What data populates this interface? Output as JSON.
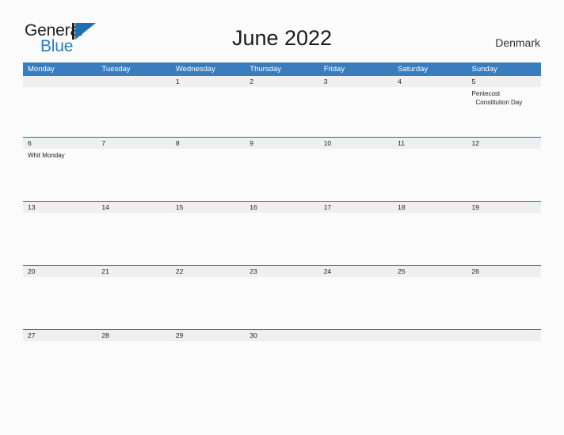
{
  "brand": {
    "name_part1": "General",
    "name_part2": "Blue",
    "accent_color": "#2b7cc0",
    "logo_flag_icon": "triangle-flag-icon"
  },
  "header": {
    "title": "June 2022",
    "country": "Denmark"
  },
  "calendar": {
    "header_bg": "#3a7dbf",
    "date_band_bg": "#efefef",
    "week_rule_color": "#2e6da4",
    "weekdays": [
      "Monday",
      "Tuesday",
      "Wednesday",
      "Thursday",
      "Friday",
      "Saturday",
      "Sunday"
    ],
    "weeks": [
      {
        "days": [
          {
            "date": "",
            "events": []
          },
          {
            "date": "",
            "events": []
          },
          {
            "date": "1",
            "events": []
          },
          {
            "date": "2",
            "events": []
          },
          {
            "date": "3",
            "events": []
          },
          {
            "date": "4",
            "events": []
          },
          {
            "date": "5",
            "events": [
              "Pentecost",
              "Constitution Day"
            ]
          }
        ]
      },
      {
        "days": [
          {
            "date": "6",
            "events": [
              "Whit Monday"
            ]
          },
          {
            "date": "7",
            "events": []
          },
          {
            "date": "8",
            "events": []
          },
          {
            "date": "9",
            "events": []
          },
          {
            "date": "10",
            "events": []
          },
          {
            "date": "11",
            "events": []
          },
          {
            "date": "12",
            "events": []
          }
        ]
      },
      {
        "days": [
          {
            "date": "13",
            "events": []
          },
          {
            "date": "14",
            "events": []
          },
          {
            "date": "15",
            "events": []
          },
          {
            "date": "16",
            "events": []
          },
          {
            "date": "17",
            "events": []
          },
          {
            "date": "18",
            "events": []
          },
          {
            "date": "19",
            "events": []
          }
        ]
      },
      {
        "days": [
          {
            "date": "20",
            "events": []
          },
          {
            "date": "21",
            "events": []
          },
          {
            "date": "22",
            "events": []
          },
          {
            "date": "23",
            "events": []
          },
          {
            "date": "24",
            "events": []
          },
          {
            "date": "25",
            "events": []
          },
          {
            "date": "26",
            "events": []
          }
        ]
      },
      {
        "days": [
          {
            "date": "27",
            "events": []
          },
          {
            "date": "28",
            "events": []
          },
          {
            "date": "29",
            "events": []
          },
          {
            "date": "30",
            "events": []
          },
          {
            "date": "",
            "events": []
          },
          {
            "date": "",
            "events": []
          },
          {
            "date": "",
            "events": []
          }
        ]
      }
    ]
  }
}
